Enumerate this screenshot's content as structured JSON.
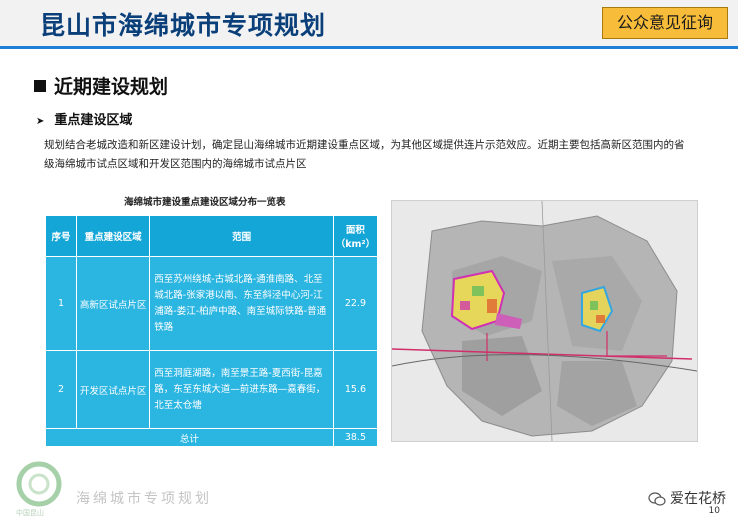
{
  "header": {
    "title": "昆山市海绵城市专项规划",
    "badge": "公众意见征询",
    "accent_color": "#1f7fd8",
    "badge_color": "#f7bd3a"
  },
  "section": {
    "title": "近期建设规划",
    "bullet_icon": "square-bullet-icon"
  },
  "subsection": {
    "title": "重点建设区域",
    "bullet_icon": "arrow-bullet-icon"
  },
  "paragraph": "规划结合老城改造和新区建设计划，确定昆山海绵城市近期建设重点区域，为其他区域提供连片示范效应。近期主要包括高新区范围内的省级海绵城市试点区域和开发区范围内的海绵城市试点片区",
  "table": {
    "title": "海绵城市建设重点建设区域分布一览表",
    "headers": [
      "序号",
      "重点建设区域",
      "范围",
      "面积（km²）"
    ],
    "rows": [
      [
        "1",
        "高新区试点片区",
        "西至苏州绕城-古城北路-通淮南路、北至城北路-张家港以南、东至斜泾中心河-江浦路-娄江-柏庐中路、南至城际铁路-普通铁路",
        "22.9"
      ],
      [
        "2",
        "开发区试点片区",
        "西至洞庭湖路，南至景王路-夏西街-昆嘉路，东至东城大道—前进东路—嘉春街，北至太仓塘",
        "15.6"
      ]
    ],
    "total_label": "总计",
    "total_value": "38.5",
    "header_color": "#15a6d8",
    "cell_color": "#2bb5e1"
  },
  "map": {
    "name": "key-construction-area-map"
  },
  "footer": {
    "brand": "海绵城市专项规划",
    "logo_text": "中国昆山",
    "wechat": "爱在花桥",
    "page_number": "10"
  }
}
